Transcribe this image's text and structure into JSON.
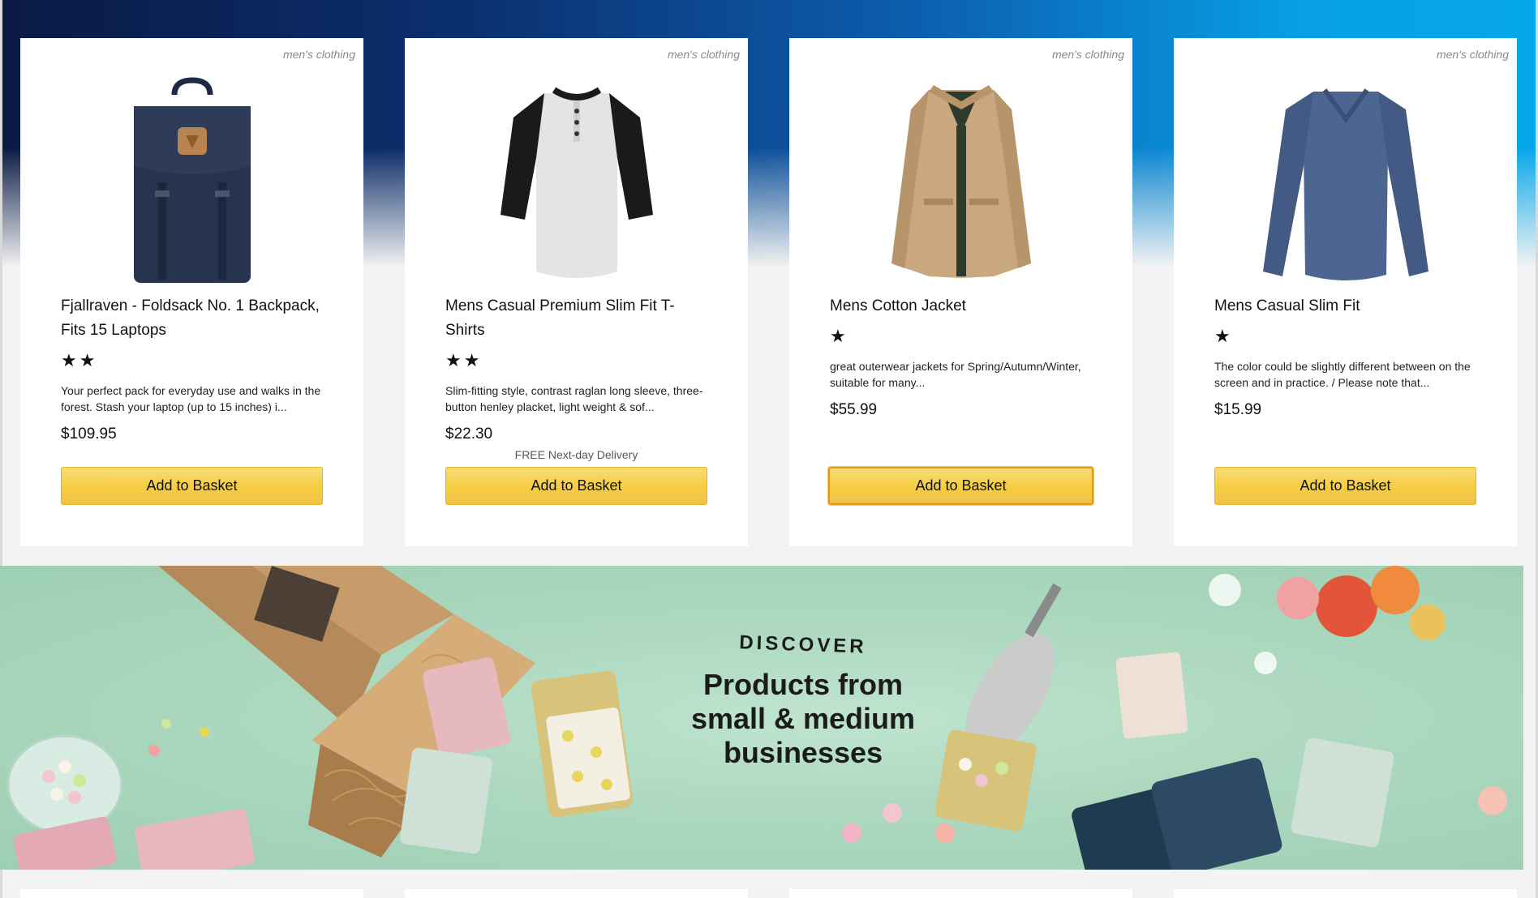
{
  "products": [
    {
      "category": "men's clothing",
      "title": "Fjallraven - Foldsack No. 1 Backpack, Fits 15 Laptops",
      "stars": "★★",
      "rating": 2,
      "description": "Your perfect pack for everyday use and walks in the forest. Stash your laptop (up to 15 inches) i...",
      "price": "$109.95",
      "delivery": "",
      "button_label": "Add to Basket",
      "image_icon": "backpack-icon"
    },
    {
      "category": "men's clothing",
      "title": "Mens Casual Premium Slim Fit T-Shirts",
      "stars": "★★",
      "rating": 2,
      "description": "Slim-fitting style, contrast raglan long sleeve, three-button henley placket, light weight & sof...",
      "price": "$22.30",
      "delivery": "FREE Next-day Delivery",
      "button_label": "Add to Basket",
      "image_icon": "raglan-shirt-icon"
    },
    {
      "category": "men's clothing",
      "title": "Mens Cotton Jacket",
      "stars": "★",
      "rating": 1,
      "description": "great outerwear jackets for Spring/Autumn/Winter, suitable for many...",
      "price": "$55.99",
      "delivery": "",
      "button_label": "Add to Basket",
      "image_icon": "jacket-icon"
    },
    {
      "category": "men's clothing",
      "title": "Mens Casual Slim Fit",
      "stars": "★",
      "rating": 1,
      "description": "The color could be slightly different between on the screen and in practice. / Please note that...",
      "price": "$15.99",
      "delivery": "",
      "button_label": "Add to Basket",
      "image_icon": "long-sleeve-shirt-icon"
    }
  ],
  "banner": {
    "kicker": "DISCOVER",
    "headline": "Products from small & medium businesses"
  },
  "colors": {
    "button": "#f0c14b",
    "button_border": "#e0b52b",
    "hero_dark": "#0a1a44",
    "hero_light": "#06a7ea",
    "banner_bg": "#aed9c0"
  }
}
